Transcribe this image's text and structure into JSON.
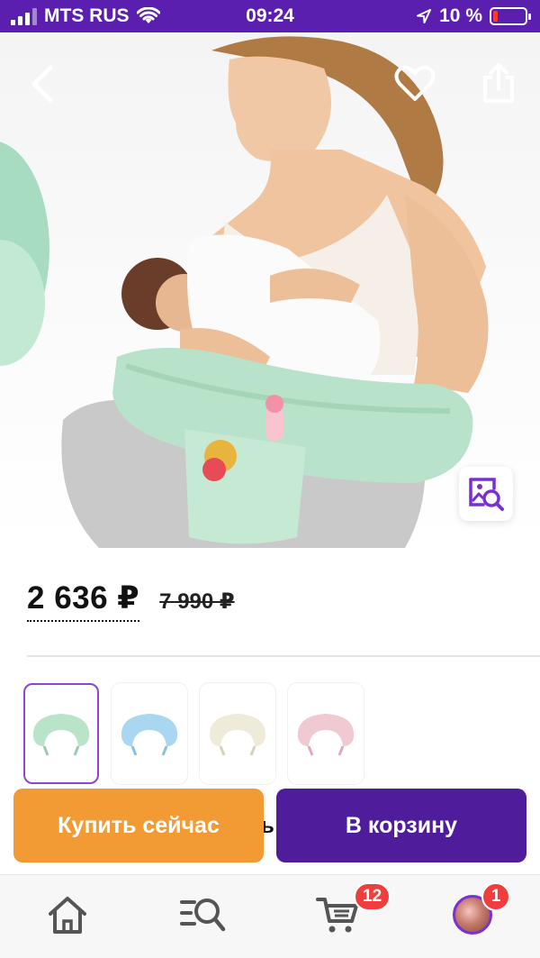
{
  "status_bar": {
    "carrier": "MTS RUS",
    "time": "09:24",
    "battery": "10 %",
    "battery_level": 0.1,
    "signal_icon": "signal-bars-icon",
    "wifi_icon": "wifi-icon",
    "location_icon": "location-arrow-icon",
    "background": "#5b1fb0"
  },
  "hero": {
    "back_icon": "chevron-left-icon",
    "favorite_icon": "heart-icon",
    "share_icon": "share-icon",
    "image_search_icon": "image-search-icon"
  },
  "product": {
    "price": "2 636 ₽",
    "old_price": "7 990 ₽",
    "partially_hidden_text": "ь"
  },
  "variants": [
    {
      "color": "#b9e4c9",
      "selected": true
    },
    {
      "color": "#a9d6f0",
      "selected": false
    },
    {
      "color": "#eeebd9",
      "selected": false
    },
    {
      "color": "#f1c9d3",
      "selected": false
    }
  ],
  "actions": {
    "buy_now": "Купить сейчас",
    "add_to_cart": "В корзину",
    "buy_now_color": "#f29a33",
    "add_to_cart_color": "#4f1d9c"
  },
  "tabbar": {
    "home_icon": "home-icon",
    "catalog_icon": "catalog-search-icon",
    "cart_icon": "cart-icon",
    "cart_badge": "12",
    "profile_badge": "1",
    "badge_color": "#f03e3e"
  }
}
